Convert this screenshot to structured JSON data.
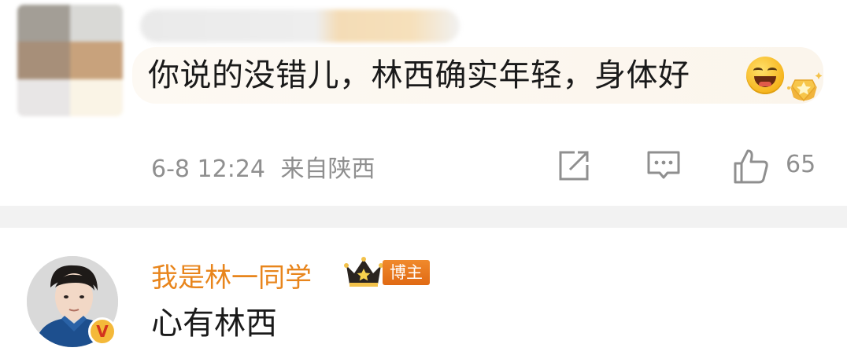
{
  "comments": [
    {
      "text": "你说的没错儿，林西确实年轻，身体好",
      "date": "6-8 12:24",
      "location": "来自陕西",
      "like_count": "65"
    },
    {
      "username": "我是林一同学",
      "tag": "博主",
      "verified_badge": "V",
      "text": "心有林西"
    }
  ],
  "icons": [
    "share-icon",
    "comment-icon",
    "like-icon",
    "crown-icon",
    "star-badge-icon",
    "grin-emoji-icon",
    "verified-badge-icon"
  ],
  "colors": {
    "username": "#e8851c",
    "meta_gray": "#8f8f8f",
    "tag_orange": "#e8761c",
    "bubble_bg": "#fcf7ef",
    "divider": "#f2f2f2"
  }
}
